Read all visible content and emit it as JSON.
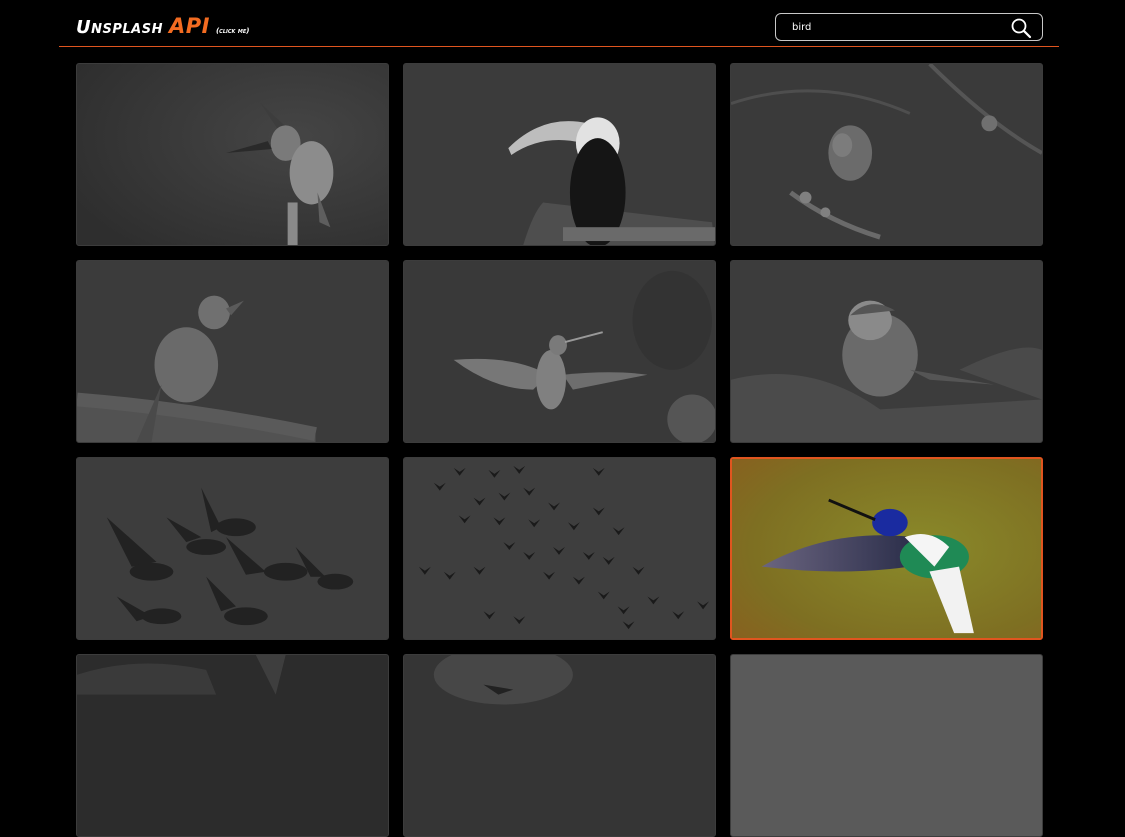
{
  "header": {
    "logo_main": "Unsplash",
    "logo_accent": "API",
    "logo_hint": "(click me)"
  },
  "search": {
    "value": "bird",
    "icon": "search-icon"
  },
  "colors": {
    "accent": "#f26b21",
    "divider": "#e0551f",
    "background": "#000000",
    "card_dim": "#3a3a3a"
  },
  "gallery": {
    "images": [
      {
        "subject": "kingfisher-on-branch"
      },
      {
        "subject": "toucan-on-branch"
      },
      {
        "subject": "small-bird-on-blossom-branch"
      },
      {
        "subject": "robin-singing-on-branch"
      },
      {
        "subject": "hummingbird-hovering"
      },
      {
        "subject": "blue-tit-in-snow"
      },
      {
        "subject": "geese-flying"
      },
      {
        "subject": "flock-of-birds"
      },
      {
        "subject": "hummingbird-color",
        "highlighted": true
      },
      {
        "subject": "partial-dark-1"
      },
      {
        "subject": "partial-dark-2"
      },
      {
        "subject": "partial-gray"
      }
    ]
  }
}
